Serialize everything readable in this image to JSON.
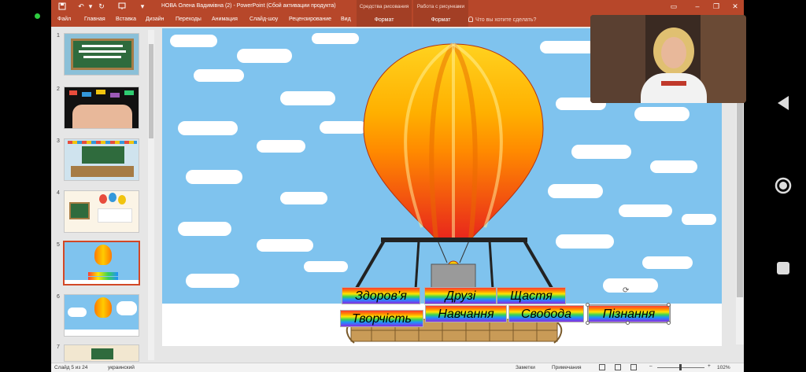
{
  "window": {
    "title": "НОВА Олена Вадимівна (2) - PowerPoint (Сбой активации продукта)",
    "context_groups": [
      "Средства рисования",
      "Работа с рисунками"
    ]
  },
  "tabs": [
    "Файл",
    "Главная",
    "Вставка",
    "Дизайн",
    "Переходы",
    "Анимация",
    "Слайд-шоу",
    "Рецензирование",
    "Вид"
  ],
  "context_tabs": [
    "Формат",
    "Формат"
  ],
  "tell_me": "Что вы хотите сделать?",
  "thumbnails": {
    "numbers": [
      "1",
      "2",
      "3",
      "4",
      "5",
      "6",
      "7"
    ],
    "selected": "5"
  },
  "slide": {
    "words": [
      "Здоров’я",
      "Друзі",
      "Щастя",
      "Творчість",
      "Навчання",
      "Свобода",
      "Пізнання"
    ]
  },
  "status": {
    "slide_counter": "Слайд 5 из 24",
    "language": "украинский",
    "notes": "Заметки",
    "comments": "Примечания",
    "zoom": "102%"
  },
  "colors": {
    "ribbon": "#b7472a",
    "sky": "#7fc3ee",
    "selection": "#d24726"
  },
  "icons": [
    "save-icon",
    "undo-icon",
    "redo-icon",
    "start-from-beginning-icon",
    "customize-quick-access-icon",
    "ribbon-display-icon",
    "minimize-icon",
    "maximize-icon",
    "close-icon",
    "back-icon",
    "home-icon",
    "recents-icon"
  ]
}
